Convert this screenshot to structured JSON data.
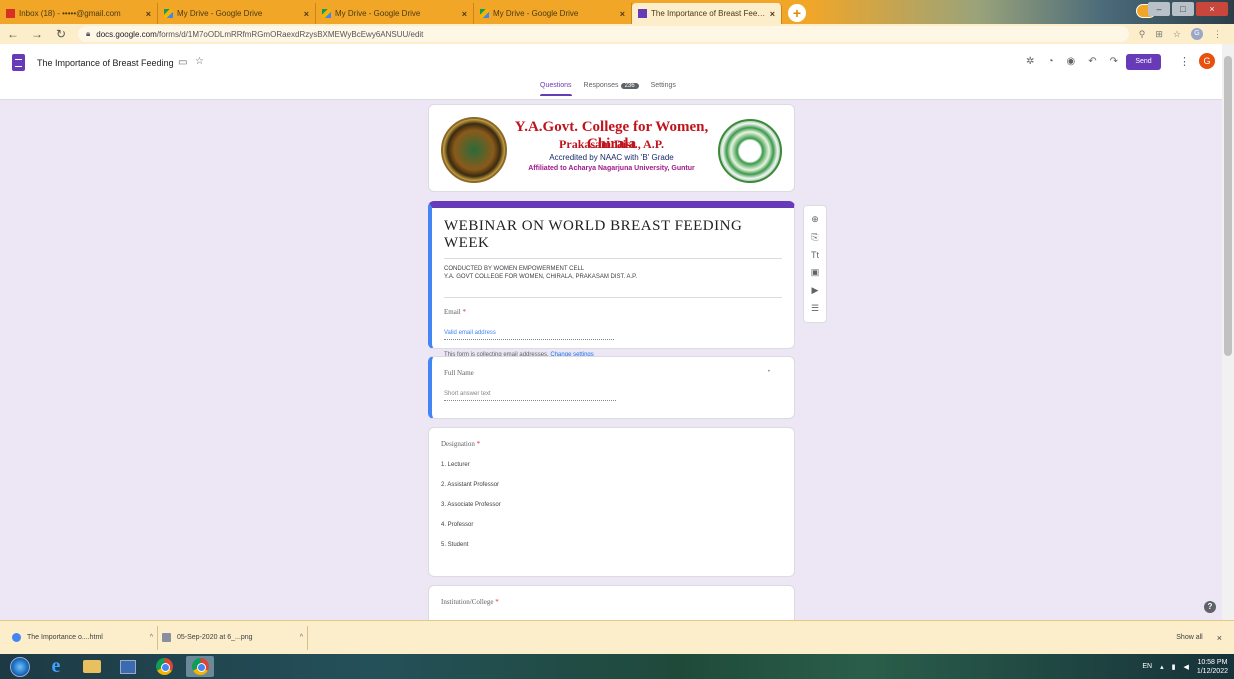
{
  "browser": {
    "tabs": [
      {
        "label": "Inbox (18) - •••••@gmail.com",
        "icon": "gmail-icon",
        "active": false
      },
      {
        "label": "My Drive - Google Drive",
        "icon": "drive-icon",
        "active": false
      },
      {
        "label": "My Drive - Google Drive",
        "icon": "drive-icon",
        "active": false
      },
      {
        "label": "My Drive - Google Drive",
        "icon": "drive-icon",
        "active": false
      },
      {
        "label": "The Importance of Breast Feedin",
        "icon": "forms-icon",
        "active": true
      }
    ],
    "new_tab": "+",
    "url_host": "docs.google.com",
    "url_path": "/forms/d/1M7oODLmRRfmRGmORaexdRzysBXMEWyBcEwy6ANSUU/edit"
  },
  "form_header": {
    "title": "The Importance of Breast Feeding",
    "send_label": "Send",
    "user_initial": "G",
    "tabs": {
      "questions": "Questions",
      "responses": "Responses",
      "responses_count": "236",
      "settings": "Settings"
    }
  },
  "banner": {
    "college_name": "Y.A.Govt. College for Women, Chirala",
    "district": "Prakasam Dist., A.P.",
    "accreditation": "Accredited by NAAC with 'B' Grade",
    "affiliation": "Affiliated to Acharya Nagarjuna University, Guntur"
  },
  "title_card": {
    "title": "WEBINAR ON WORLD BREAST FEEDING WEEK",
    "desc_line1": "CONDUCTED BY WOMEN EMPOWERMENT CELL",
    "desc_line2": "Y.A. GOVT COLLEGE FOR WOMEN, CHIRALA, PRAKASAM DIST. A.P.",
    "email_label": "Email",
    "required_mark": "*",
    "email_placeholder": "Valid email address",
    "collect_note": "This form is collecting email addresses.",
    "change_settings": "Change settings"
  },
  "fullname_card": {
    "label": "Full Name",
    "placeholder": "Short answer text"
  },
  "designation_card": {
    "label": "Designation",
    "options": [
      "1. Lecturer",
      "2. Assistant Professor",
      "3. Associate Professor",
      "4. Professor",
      "5. Student"
    ]
  },
  "institution_card": {
    "label": "Institution/College"
  },
  "downloads": {
    "items": [
      {
        "label": "The Importance o....html",
        "icon": "chrome-icon"
      },
      {
        "label": "05-Sep-2020 at 6_...png",
        "icon": "image-file-icon"
      }
    ],
    "show_all": "Show all"
  },
  "taskbar": {
    "language": "EN",
    "time": "10:58 PM",
    "date": "1/12/2022"
  },
  "colors": {
    "accent": "#673ab7",
    "focus_border": "#4285f4",
    "background": "#ece6f5",
    "tabstrip": "#f2a627",
    "title_red": "#c0141c"
  }
}
